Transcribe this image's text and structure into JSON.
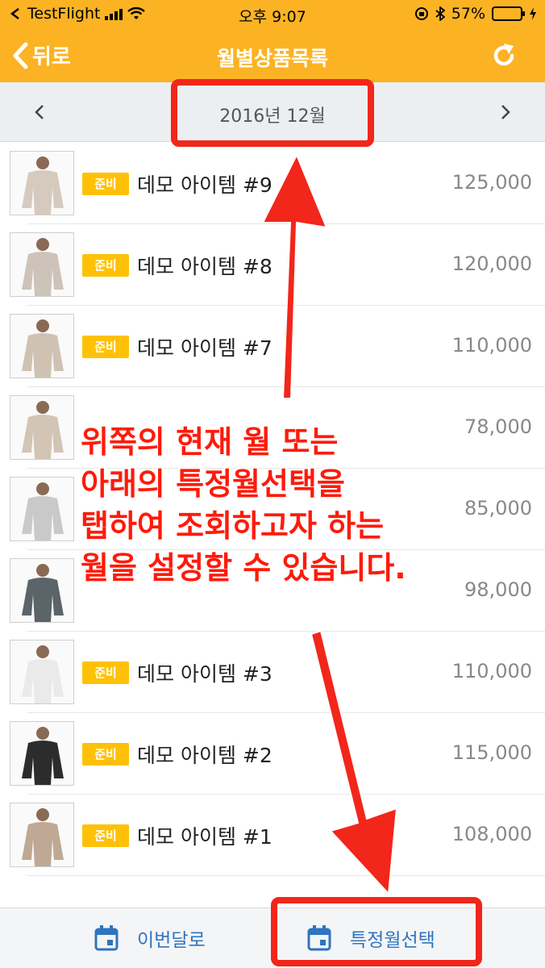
{
  "status_bar": {
    "app_name": "TestFlight",
    "time": "오후 9:07",
    "battery": "57%",
    "battery_level": 0.57
  },
  "nav": {
    "back_label": "뒤로",
    "title": "월별상품목록",
    "accent_color": "#fbb324"
  },
  "month_selector": {
    "label": "2016년 12월"
  },
  "products": [
    {
      "badge": "준비",
      "name": "데모 아이템 #9",
      "price": "125,000"
    },
    {
      "badge": "준비",
      "name": "데모 아이템 #8",
      "price": "120,000"
    },
    {
      "badge": "준비",
      "name": "데모 아이템 #7",
      "price": "110,000"
    },
    {
      "badge": "",
      "name": "",
      "price": "78,000"
    },
    {
      "badge": "",
      "name": "",
      "price": "85,000"
    },
    {
      "badge": "",
      "name": "",
      "price": "98,000"
    },
    {
      "badge": "준비",
      "name": "데모 아이템 #3",
      "price": "110,000"
    },
    {
      "badge": "준비",
      "name": "데모 아이템 #2",
      "price": "115,000"
    },
    {
      "badge": "준비",
      "name": "데모 아이템 #1",
      "price": "108,000"
    }
  ],
  "bottom_bar": {
    "this_month_label": "이번달로",
    "select_month_label": "특정월선택"
  },
  "tutorial": {
    "lines": [
      "위쪽의 현재 월 또는",
      "아래의 특정월선택을",
      "탭하여 조회하고자 하는",
      "월을 설정할 수 있습니다."
    ],
    "color": "#f2261a"
  }
}
